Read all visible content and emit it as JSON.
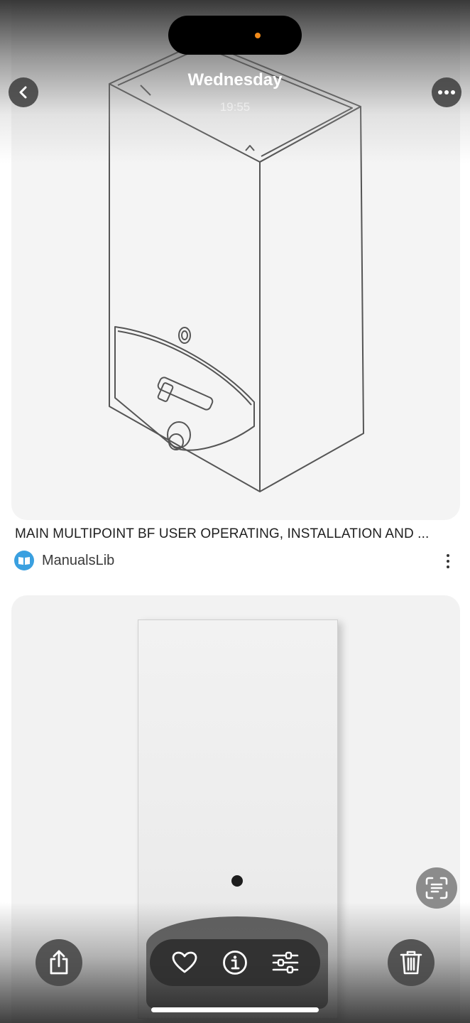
{
  "header": {
    "day": "Wednesday",
    "time": "19:55"
  },
  "results": [
    {
      "title": "MAIN MULTIPOINT BF USER OPERATING, INSTALLATION AND ...",
      "source": "ManualsLib",
      "image_description_icon": "water-heater-line-drawing"
    },
    {
      "image_description_icon": "water-heater-photo"
    }
  ],
  "toolbar": {
    "buttons": [
      "share-icon",
      "heart-icon",
      "info-icon",
      "adjust-icon",
      "trash-icon"
    ]
  },
  "colors": {
    "island_dot": "#f08a1a",
    "source_logo": "#3aa0e0"
  }
}
